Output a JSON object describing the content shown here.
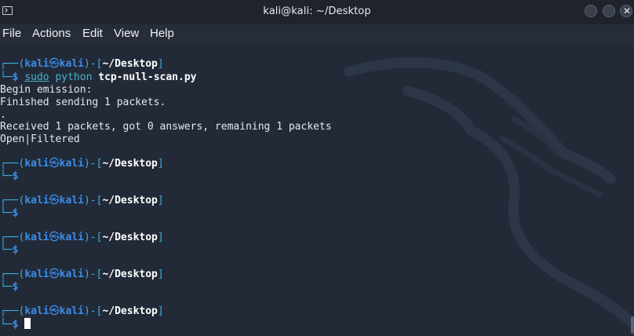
{
  "window": {
    "title": "kali@kali: ~/Desktop",
    "close_glyph": "✕"
  },
  "menu": {
    "items": [
      "File",
      "Actions",
      "Edit",
      "View",
      "Help"
    ]
  },
  "prompt": {
    "corner_top": "┌──",
    "open_paren": "(",
    "user": "kali",
    "at_symbol": "㉿",
    "host": "kali",
    "close_bracket": ")-[",
    "path": "~/Desktop",
    "end_bracket": "]",
    "corner_bottom": "└─",
    "dollar": "$"
  },
  "command": {
    "sudo": "sudo",
    "interpreter": "python",
    "script": "tcp-null-scan.py"
  },
  "output": [
    "Begin emission:",
    "Finished sending 1 packets.",
    ".",
    "Received 1 packets, got 0 answers, remaining 1 packets",
    "Open|Filtered"
  ],
  "colors": {
    "background": "#222a38",
    "prompt_blue": "#3b8eea",
    "frame_cyan": "#3daee9",
    "command_cyan": "#4ab0c8",
    "text": "#e6e8ec"
  },
  "icons": {
    "terminal": "terminal-window-icon",
    "minimize": "minimize-icon",
    "maximize": "maximize-icon",
    "close": "close-icon",
    "background": "kali-dragon-logo"
  }
}
